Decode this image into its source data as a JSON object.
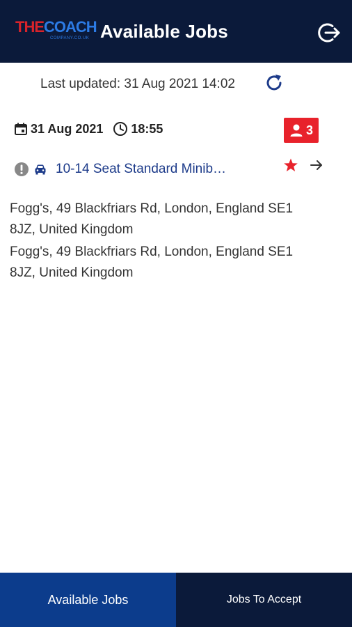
{
  "header": {
    "logo_the": "THE",
    "logo_coach": "COACH",
    "logo_sub": "COMPANY.CO.UK",
    "title": "Available Jobs",
    "logout_icon": "logout-icon"
  },
  "status": {
    "last_updated": "Last updated: 31 Aug 2021 14:02",
    "refresh_icon": "refresh-icon"
  },
  "job": {
    "date": "31 Aug 2021",
    "time": "18:55",
    "passengers": "3",
    "vehicle": "10-14 Seat Standard Minib…",
    "pickup_address": "Fogg's, 49 Blackfriars Rd, London, England SE1 8JZ, United Kingdom",
    "dropoff_address": "Fogg's, 49 Blackfriars Rd, London, England SE1 8JZ, United Kingdom",
    "badge_color": "#e8222b",
    "star_color": "#e8222b"
  },
  "nav": {
    "tabs": [
      {
        "label": "Available Jobs",
        "active": true
      },
      {
        "label": "Jobs To Accept",
        "active": false
      }
    ]
  },
  "colors": {
    "header_bg": "#0b1a3a",
    "active_tab_bg": "#0c3c8c",
    "vehicle_text": "#1d3b8a"
  }
}
